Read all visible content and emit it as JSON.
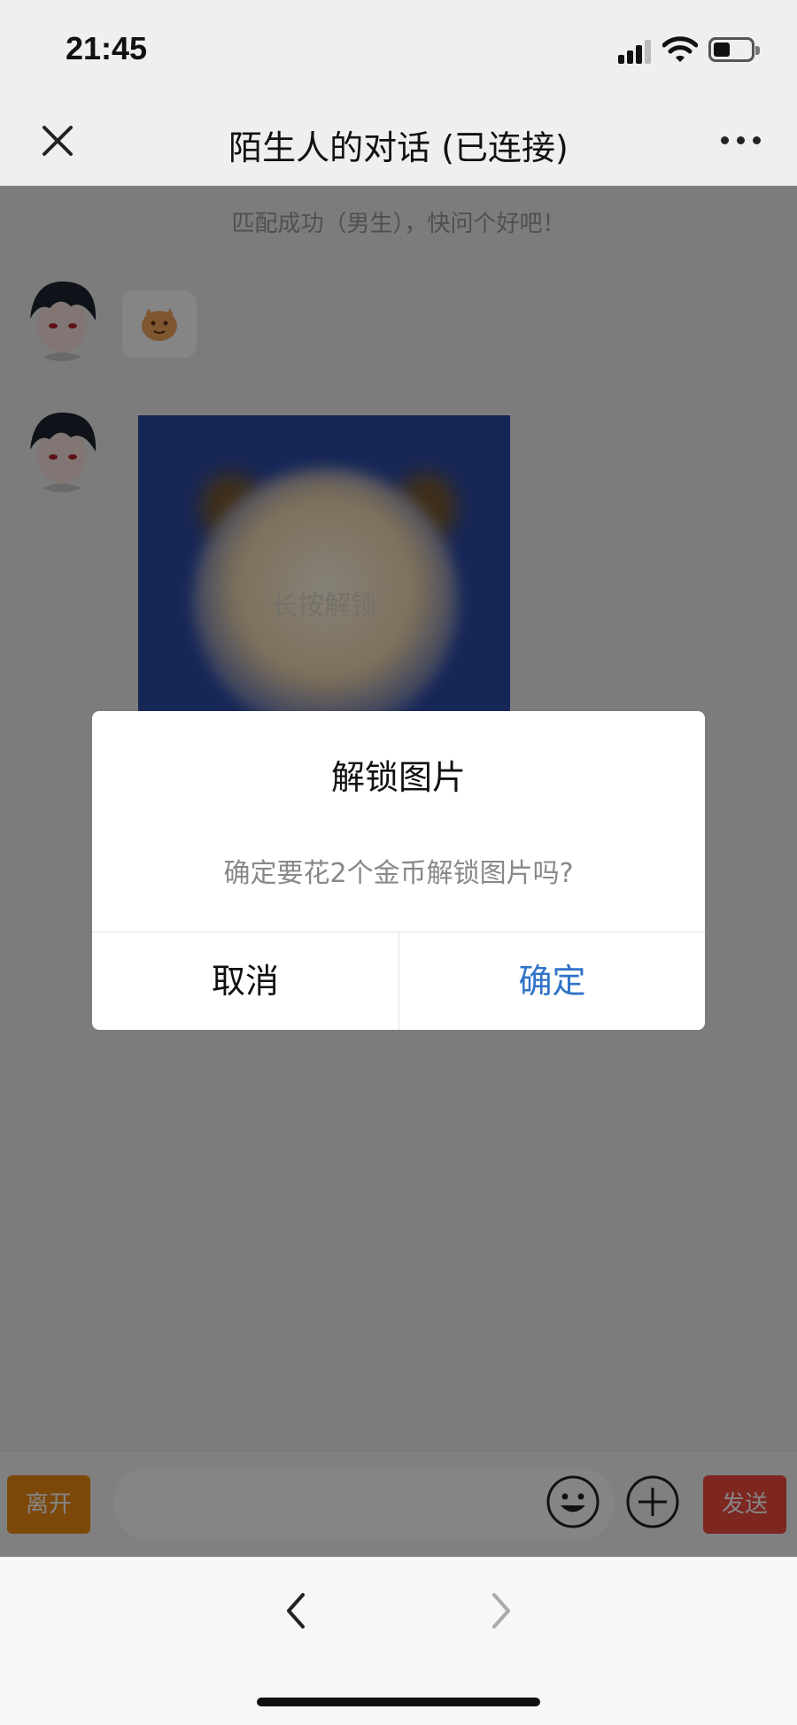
{
  "status_bar": {
    "time": "21:45"
  },
  "header": {
    "title": "陌生人的对话 (已连接)"
  },
  "chat": {
    "match_tip": "匹配成功（男生），快问个好吧！",
    "image_hint": "长按解锁"
  },
  "input_bar": {
    "leave_label": "离开",
    "send_label": "发送",
    "placeholder": ""
  },
  "dialog": {
    "title": "解锁图片",
    "message": "确定要花2个金币解锁图片吗?",
    "cancel_label": "取消",
    "confirm_label": "确定"
  },
  "colors": {
    "accent_blue": "#2f73c8",
    "leave_orange": "#ee8a14",
    "send_red": "#f24a3f"
  },
  "icons": [
    "close-icon",
    "more-icon",
    "emoji-icon",
    "plus-icon",
    "back-icon",
    "forward-icon",
    "signal-icon",
    "wifi-icon",
    "battery-icon"
  ]
}
